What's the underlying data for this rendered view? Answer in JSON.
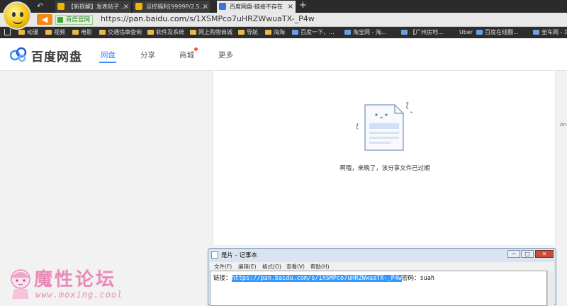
{
  "browser": {
    "tabs": [
      {
        "label": "【新提醒】发表帖子 ..."
      },
      {
        "label": "足控福利[9999P/2.5..."
      },
      {
        "label": "百度网盘-链接不存在"
      }
    ],
    "secure_badge": "百度官网",
    "url_scheme": "https://",
    "url_host": "pan.baidu.com",
    "url_path": "/s/1XSMPco7uHRZWwuaTX-_P4w",
    "bookmarks": [
      "动漫",
      "视频",
      "电影",
      "交通违章查询",
      "软件及系统",
      "网上购物商城",
      "导航",
      "海淘",
      "百度一下，...",
      "淘宝网 - 淘...",
      "【广州房地...",
      "Uber",
      "百度在线翻...",
      "坐车网 - 北京"
    ]
  },
  "site": {
    "brand": "百度网盘",
    "nav": [
      "网盘",
      "分享",
      "商城",
      "更多"
    ]
  },
  "content": {
    "message": "啊哦，来晚了，该分享文件已过期",
    "edge_text": "An"
  },
  "notepad": {
    "title": "是片 - 记事本",
    "menu": [
      "文件(F)",
      "编辑(E)",
      "格式(O)",
      "查看(V)",
      "帮助(H)"
    ],
    "link_label": "链接：",
    "link_url": "https://pan.baidu.com/s/1XSMPco7uHRZWwuaTX-_P4w",
    "pw_label": "密码：",
    "pw_value": "suah"
  },
  "watermark": {
    "text_cn": "魔性论坛",
    "url": "www.moxing.cool"
  },
  "colors": {
    "accent": "#3b8cff",
    "orange": "#f08a12",
    "badge_red": "#f5563b"
  }
}
